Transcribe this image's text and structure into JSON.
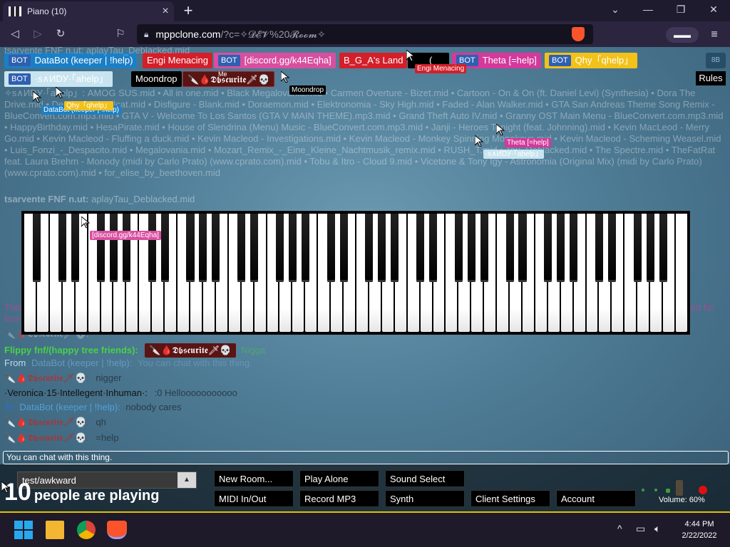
{
  "browser": {
    "tab_title": "Piano (10)",
    "url_host": "mppclone.com",
    "url_path": "/?c=✧𝓓𝓔𝓥%20𝓡𝓸𝓸𝓶✧",
    "new_tab_icon": "plus-icon",
    "close_tab_icon": "close-icon"
  },
  "name_tags": [
    {
      "label": "DataBot (keeper | !help)",
      "bot": true,
      "color": "#1b7fc6"
    },
    {
      "label": "Engi Menacing",
      "bot": false,
      "color": "#d31f2a"
    },
    {
      "label": "[discord.gg/k44Eqha]",
      "bot": true,
      "color": "#d84fa0"
    },
    {
      "label": "B_G_A's Land",
      "bot": false,
      "color": "#d31f2a"
    },
    {
      "label": "(",
      "bot": false,
      "color": "#000000"
    },
    {
      "label": "Theta [=help]",
      "bot": true,
      "color": "#d4399b"
    },
    {
      "label": "Qhy「qhelp」",
      "bot": true,
      "color": "#f2c21a"
    },
    {
      "label": "·ѕ∧ИDУ·「ahelp」",
      "bot": true,
      "color": "#c8e4f0"
    },
    {
      "label": "Moondrop",
      "bot": false,
      "color": "#000000"
    },
    {
      "label": "🔪🩸𝕯𝖇𝖘𝖈𝖚𝖗𝖎𝖙𝖊🗡💀",
      "bot": false,
      "color": "#5a1414"
    }
  ],
  "bot_badge": "BOT",
  "me_label": "Me",
  "rules_label": "Rules",
  "bb_label": "8B",
  "chat": {
    "midi_list": "✧ѕ∧ИDУ·「ahelp」: AMOG SUS.mid • All in one.mid • Black Megalovania.mid • Carmen Overture - Bizet.mid • Cartoon - On & On (ft. Daniel Levi) (Synthesia) • Dora The Drive.mid • Desmeon - Hellcat.mid • Disfigure - Blank.mid • Doraemon.mid • Elektronomia - Sky High.mid • Faded - Alan Walker.mid • GTA San Andreas Theme Song Remix - BlueConvert.com.mp3.mid • GTA V - Welcome To Los Santos (GTA V MAIN THEME).mp3.mid • Grand Theft Auto IV.mid • Granny OST Main Menu - BlueConvert.com.mp3.mid • HappyBirthday.mid • HesaPirate.mid • House of Slendrina (Menu) Music - BlueConvert.com.mp3.mid • Janji - Heroes Tonight (feat. Johnning).mid • Kevin MacLeod - Merry Go.mid • Kevin Macleod - Fluffing a duck.mid • Kevin Macleod - Investigations.mid • Kevin Macleod - Monkey Spinning Monekeys.mid • Kevin Macleod - Scheming Weasel.mid • Luis_Fonzi_-_Despacito.mid • Megalovania.mid • Mozart_Remix_-_Eine_Kleine_Nachtmusik_remix.mid • RUSH_T.mid • Tau_Deblacked.mid • The Spectre.mid • TheFatRat feat. Laura Brehm - Monody (midi by Carlo Prato) (www.cprato.com).mid • Tobu & Itro - Cloud 9.mid • Vicetone & Tony Igy - Astronomia (Original Mix) (midi by Carlo Prato) (www.cprato.com).mid • for_elise_by_beethoven.mid",
    "line_play_name": "tsarvente FNF n.ut:",
    "line_play_msg": "aplayTau_Deblacked.mid",
    "behind_right": "ved for",
    "behind_left_1": "This",
    "behind_left_2": "fore",
    "flippy_name": "Flippy fnf/(happy tree friends):",
    "flippy_tag": "🔪🩸𝕯𝖇𝖘𝖈𝖚𝖗𝖎𝖙𝖊🗡💀",
    "flippy_msg": "Nigga",
    "from_label": "From",
    "from_name": "DataBot (keeper | !help):",
    "from_msg": "You can chat with this thing.",
    "obs_name": "🔪🩸𝕯𝖇𝖘𝖈𝖚𝖗𝖎𝖙𝖊🗡💀:",
    "obs_msg_1": "nigger",
    "veronica_name": "·Veronica·15·Intellegent·Inhuman·:",
    "veronica_msg": ":0 Hellooooooooooo",
    "to_label": "To",
    "to_name": "DataBot (keeper | !help):",
    "to_msg": "nobody cares",
    "obs_msg_2": "qh",
    "obs_msg_3": "=help"
  },
  "cursors": [
    {
      "label": "Engi Menacing",
      "color": "#d31f2a"
    },
    {
      "label": "Moondrop",
      "color": "#000000"
    },
    {
      "label": "DataBot (keeper | !help)",
      "color": "#1b7fc6"
    },
    {
      "label": "Qhy「qhelp」",
      "color": "#f2c21a"
    },
    {
      "label": "Theta [=help]",
      "color": "#d4399b"
    },
    {
      "label": "·ѕ∧ИDУ·「ahelp」",
      "color": "#c8e4f0"
    },
    {
      "label": "[discord.gg/k44Eqha]",
      "color": "#d84fa0"
    }
  ],
  "chat_input_placeholder": "You can chat with this thing.",
  "room_select_value": "test/awkward",
  "people_count": "10",
  "people_text": "people are playing",
  "buttons": {
    "new_room": "New Room...",
    "play_alone": "Play Alone",
    "sound_select": "Sound Select",
    "midi": "MIDI In/Out",
    "record": "Record MP3",
    "synth": "Synth",
    "client_settings": "Client Settings",
    "account": "Account"
  },
  "volume_label": "Volume: 60%",
  "taskbar": {
    "time": "4:44 PM",
    "date": "2/22/2022"
  }
}
